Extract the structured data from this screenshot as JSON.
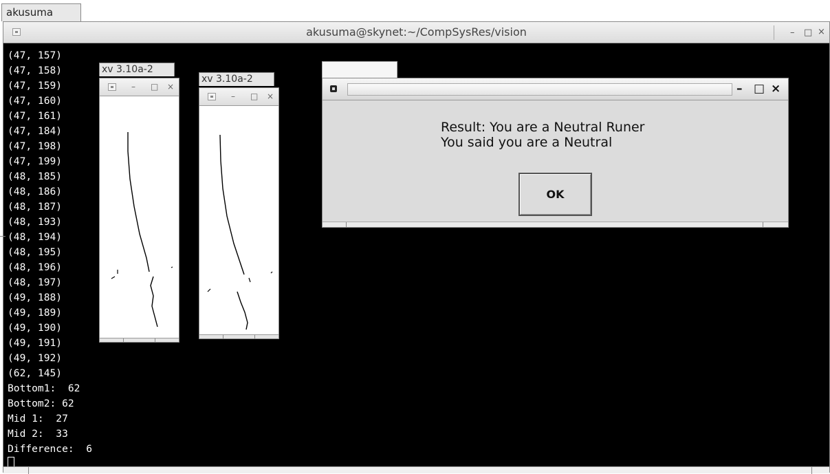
{
  "taskbar_tab": {
    "label": "akusuma"
  },
  "terminal": {
    "title": "akusuma@skynet:~/CompSysRes/vision",
    "output_lines": [
      "(47, 157)",
      "(47, 158)",
      "(47, 159)",
      "(47, 160)",
      "(47, 161)",
      "(47, 184)",
      "(47, 198)",
      "(47, 199)",
      "(48, 185)",
      "(48, 186)",
      "(48, 187)",
      "(48, 193)",
      "(48, 194)",
      "(48, 195)",
      "(48, 196)",
      "(48, 197)",
      "(49, 188)",
      "(49, 189)",
      "(49, 190)",
      "(49, 191)",
      "(49, 192)",
      "(62, 145)",
      "Bottom1:  62",
      "Bottom2: 62",
      "Mid 1:  27",
      "Mid 2:  33",
      "Difference:  6"
    ],
    "buttons": {
      "minimize": "–",
      "maximize": "□",
      "close": "×"
    }
  },
  "xv_window_1": {
    "tab_label": "xv 3.10a-2"
  },
  "xv_window_2": {
    "tab_label": "xv 3.10a-2"
  },
  "dialog": {
    "title": "",
    "message_line1": "Result: You are a Neutral Runer",
    "message_line2": "You said you are a Neutral",
    "ok_label": "OK",
    "buttons": {
      "minimize": "–",
      "maximize": "□",
      "close": "×"
    }
  }
}
